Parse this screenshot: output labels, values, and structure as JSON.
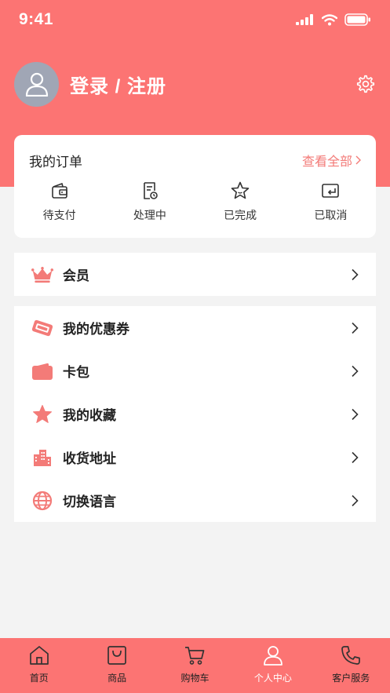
{
  "status": {
    "time": "9:41"
  },
  "profile": {
    "login_label": "登录 / 注册"
  },
  "orders": {
    "title": "我的订单",
    "view_all": "查看全部",
    "items": [
      {
        "label": "待支付",
        "icon": "wallet-icon"
      },
      {
        "label": "处理中",
        "icon": "document-icon"
      },
      {
        "label": "已完成",
        "icon": "star-outline-icon"
      },
      {
        "label": "已取消",
        "icon": "card-return-icon"
      }
    ]
  },
  "membership": {
    "label": "会员",
    "icon": "crown-icon"
  },
  "menu": {
    "items": [
      {
        "label": "我的优惠券",
        "icon": "coupon-icon"
      },
      {
        "label": "卡包",
        "icon": "card-wallet-icon"
      },
      {
        "label": "我的收藏",
        "icon": "star-icon"
      },
      {
        "label": "收货地址",
        "icon": "building-icon"
      },
      {
        "label": "切换语言",
        "icon": "globe-icon"
      }
    ]
  },
  "tabbar": {
    "items": [
      {
        "label": "首页",
        "icon": "home-icon"
      },
      {
        "label": "商品",
        "icon": "bag-icon"
      },
      {
        "label": "购物车",
        "icon": "cart-icon"
      },
      {
        "label": "个人中心",
        "icon": "person-icon",
        "active": true
      },
      {
        "label": "客户服务",
        "icon": "phone-icon"
      }
    ]
  },
  "colors": {
    "accent": "#fc7473",
    "background": "#f3f3f3",
    "link": "#f37b78"
  }
}
